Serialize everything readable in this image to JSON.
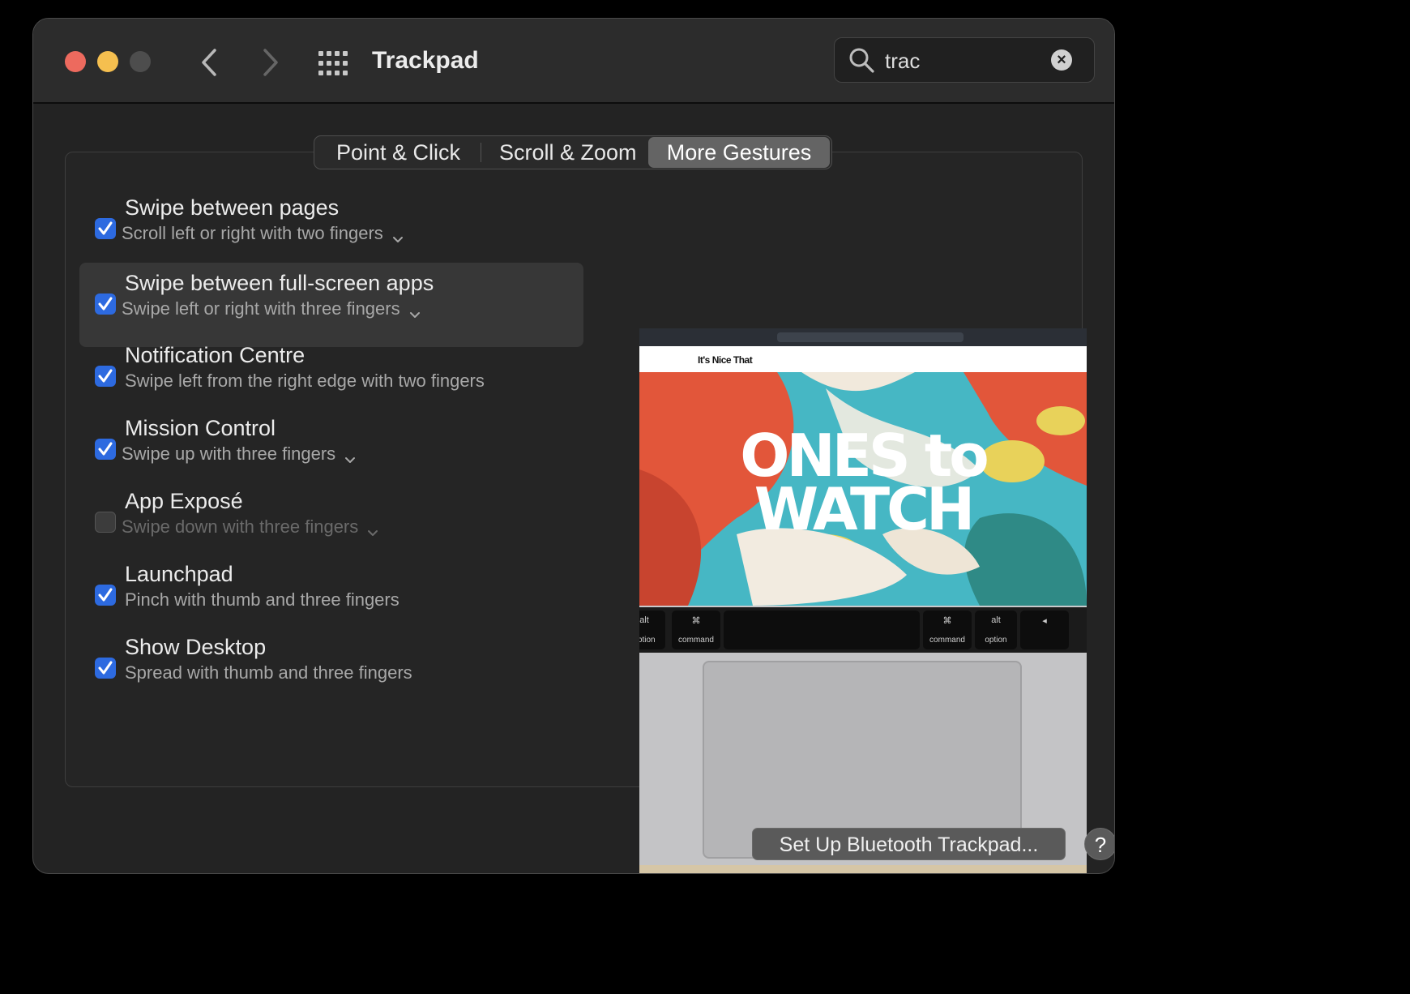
{
  "window": {
    "title": "Trackpad",
    "traffic_lights": [
      "close",
      "minimize",
      "zoom-disabled"
    ]
  },
  "toolbar": {
    "back_icon": "chevron-left-icon",
    "forward_icon": "chevron-right-icon",
    "show_all_icon": "grid-icon"
  },
  "search": {
    "value": "trac",
    "clear_symbol": "×"
  },
  "tabs": [
    {
      "label": "Point & Click",
      "selected": false
    },
    {
      "label": "Scroll & Zoom",
      "selected": false
    },
    {
      "label": "More Gestures",
      "selected": true
    }
  ],
  "gestures": [
    {
      "name": "Swipe between pages",
      "description": "Scroll left or right with two fingers",
      "checked": true,
      "has_menu": true
    },
    {
      "name": "Swipe between full-screen apps",
      "description": "Swipe left or right with three fingers",
      "checked": true,
      "has_menu": true,
      "highlighted": true
    },
    {
      "name": "Notification Centre",
      "description": "Swipe left from the right edge with two fingers",
      "checked": true,
      "has_menu": false
    },
    {
      "name": "Mission Control",
      "description": "Swipe up with three fingers",
      "checked": true,
      "has_menu": true
    },
    {
      "name": "App Exposé",
      "description": "Swipe down with three fingers",
      "checked": false,
      "has_menu": true
    },
    {
      "name": "Launchpad",
      "description": "Pinch with thumb and three fingers",
      "checked": true,
      "has_menu": false
    },
    {
      "name": "Show Desktop",
      "description": "Spread with thumb and three fingers",
      "checked": true,
      "has_menu": false
    }
  ],
  "preview": {
    "site_name": "It's Nice That",
    "hero_line1": "ONES to",
    "hero_line2": "WATCH",
    "keys": [
      {
        "top": "alt",
        "bottom": "option"
      },
      {
        "top": "⌘",
        "bottom": "command"
      },
      {
        "top": "",
        "bottom": ""
      },
      {
        "top": "⌘",
        "bottom": "command"
      },
      {
        "top": "alt",
        "bottom": "option"
      },
      {
        "top": "◂",
        "bottom": ""
      }
    ]
  },
  "footer": {
    "setup_label": "Set Up Bluetooth Trackpad...",
    "help_label": "?"
  },
  "colors": {
    "accent": "#2d6ae0",
    "close": "#ed6a5e",
    "minimize": "#f5bf4f"
  }
}
